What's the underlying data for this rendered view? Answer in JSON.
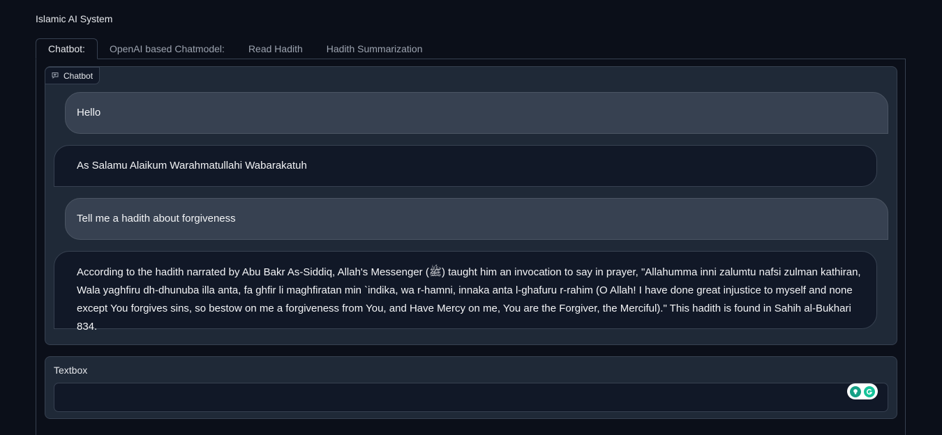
{
  "app": {
    "title": "Islamic AI System"
  },
  "tabs": [
    {
      "label": "Chatbot:"
    },
    {
      "label": "OpenAI based Chatmodel:"
    },
    {
      "label": "Read Hadith"
    },
    {
      "label": "Hadith Summarization"
    }
  ],
  "chatbot": {
    "label": "Chatbot",
    "messages": [
      {
        "role": "user",
        "text": "Hello"
      },
      {
        "role": "bot",
        "text": "As Salamu Alaikum Warahmatullahi Wabarakatuh"
      },
      {
        "role": "user",
        "text": "Tell me a hadith about forgiveness"
      },
      {
        "role": "bot",
        "text": "According to the hadith narrated by Abu Bakr As-Siddiq, Allah's Messenger (ﷺ) taught him an invocation to say in prayer, \"Allahumma inni zalumtu nafsi zulman kathiran, Wala yaghfiru dh-dhunuba illa anta, fa ghfir li maghfiratan min `indika, wa r-hamni, innaka anta l-ghafuru r-rahim (O Allah! I have done great injustice to myself and none except You forgives sins, so bestow on me a forgiveness from You, and Have Mercy on me, You are the Forgiver, the Merciful).\" This hadith is found in Sahih al-Bukhari 834."
      }
    ]
  },
  "textbox": {
    "label": "Textbox",
    "value": "",
    "placeholder": ""
  },
  "icons": {
    "chat_label": "chat-bubble-icon",
    "extension_1": "lightbulb-icon",
    "extension_2": "grammarly-icon"
  }
}
